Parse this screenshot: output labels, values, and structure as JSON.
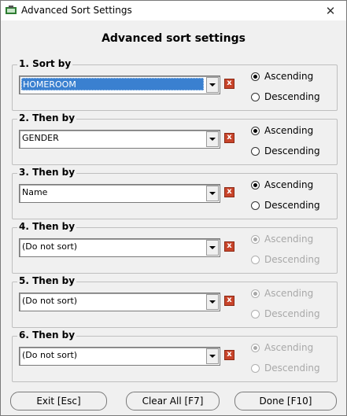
{
  "window": {
    "title": "Advanced Sort Settings",
    "close": "✕"
  },
  "heading": "Advanced sort settings",
  "groups": [
    {
      "label": "1. Sort by",
      "value": "HOMEROOM",
      "selected": true,
      "order": "Ascending",
      "enabled": true
    },
    {
      "label": "2. Then by",
      "value": "GENDER",
      "selected": false,
      "order": "Ascending",
      "enabled": true
    },
    {
      "label": "3. Then by",
      "value": "Name",
      "selected": false,
      "order": "Ascending",
      "enabled": true
    },
    {
      "label": "4. Then by",
      "value": "(Do not sort)",
      "selected": false,
      "order": "Ascending",
      "enabled": false
    },
    {
      "label": "5. Then by",
      "value": "(Do not sort)",
      "selected": false,
      "order": "Ascending",
      "enabled": false
    },
    {
      "label": "6. Then by",
      "value": "(Do not sort)",
      "selected": false,
      "order": "Ascending",
      "enabled": false
    }
  ],
  "order_labels": {
    "asc": "Ascending",
    "desc": "Descending"
  },
  "clear_icon": "x",
  "buttons": {
    "exit": "Exit [Esc]",
    "clear_all": "Clear All [F7]",
    "done": "Done [F10]"
  }
}
